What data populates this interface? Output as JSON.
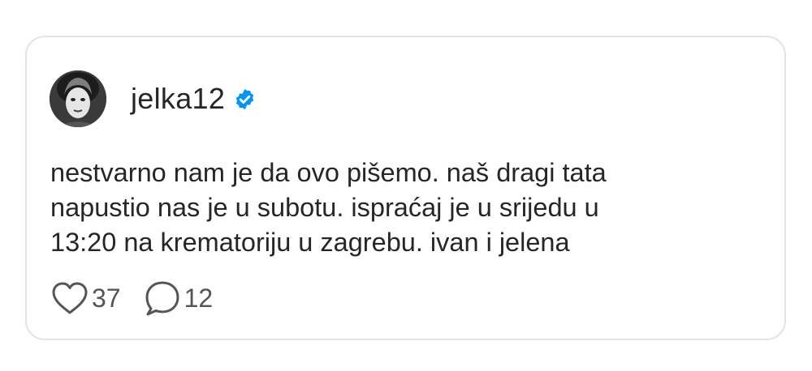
{
  "post": {
    "username": "jelka12",
    "verified": true,
    "text": "nestvarno nam je da ovo pišemo. naš dragi tata\nnapustio nas je u subotu. ispraćaj je u srijedu u\n13:20 na krematoriju u zagrebu. ivan i jelena",
    "likes": "37",
    "comments": "12"
  },
  "icons": {
    "verified": "verified-badge-icon",
    "like": "heart-icon",
    "comment": "speech-bubble-icon"
  },
  "colors": {
    "verified_blue": "#0095f6",
    "text": "#262626",
    "border": "#e4e4e4"
  }
}
